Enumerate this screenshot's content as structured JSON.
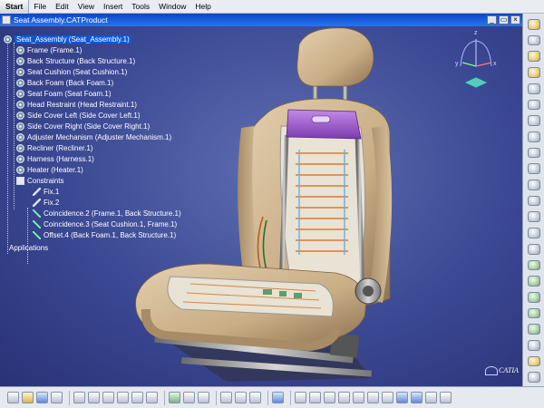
{
  "menubar": {
    "items": [
      "Start",
      "File",
      "Edit",
      "View",
      "Insert",
      "Tools",
      "Window",
      "Help"
    ]
  },
  "window": {
    "title": "Seat Assembly.CATProduct",
    "minimize": "_",
    "restore": "▭",
    "close": "×"
  },
  "tree": {
    "root": "Seat_Assembly (Seat_Assembly.1)",
    "parts": [
      "Frame (Frame.1)",
      "Back Structure (Back Structure.1)",
      "Seat Cushion (Seat Cushion.1)",
      "Back Foam (Back Foam.1)",
      "Seat Foam (Seat Foam.1)",
      "Head Restraint (Head Restraint.1)",
      "Side Cover Left (Side Cover Left.1)",
      "Side Cover Right (Side Cover Right.1)",
      "Adjuster Mechanism (Adjuster Mechanism.1)",
      "Recliner (Recliner.1)",
      "Harness (Harness.1)",
      "Heater (Heater.1)"
    ],
    "constraints_label": "Constraints",
    "constraints": [
      "Fix.1",
      "Fix.2",
      "Coincidence.2 (Frame.1, Back Structure.1)",
      "Coincidence.3 (Seat Cushion.1, Frame.1)",
      "Offset.4 (Back Foam.1, Back Structure.1)"
    ],
    "applications": "Applications"
  },
  "compass": {
    "z": "z",
    "y": "y",
    "x": "x"
  },
  "logo": "CATIA",
  "colors": {
    "viewport_center": "#5f6fb3",
    "viewport_edge": "#2a3276",
    "titlebar": "#0a46c4",
    "selection": "#0c59d8",
    "seat_leather": "#c9ad85",
    "seat_accent": "#9b58c9"
  }
}
